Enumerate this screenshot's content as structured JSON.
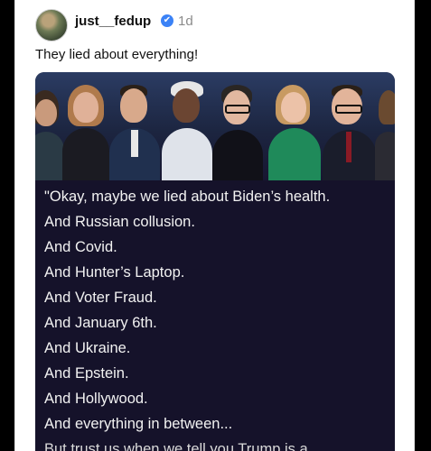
{
  "post": {
    "username": "just__fedup",
    "verified_icon": "✔",
    "time_ago": "1d",
    "text": "They lied about everything!"
  },
  "image": {
    "lines": [
      "\"Okay, maybe we lied about Biden’s health.",
      "And Russian collusion.",
      "And Covid.",
      "And Hunter’s Laptop.",
      "And Voter Fraud.",
      "And January 6th.",
      "And Ukraine.",
      "And Epstein.",
      "And Hollywood.",
      "And everything in between...",
      "But trust us when we tell you Trump is a"
    ]
  }
}
